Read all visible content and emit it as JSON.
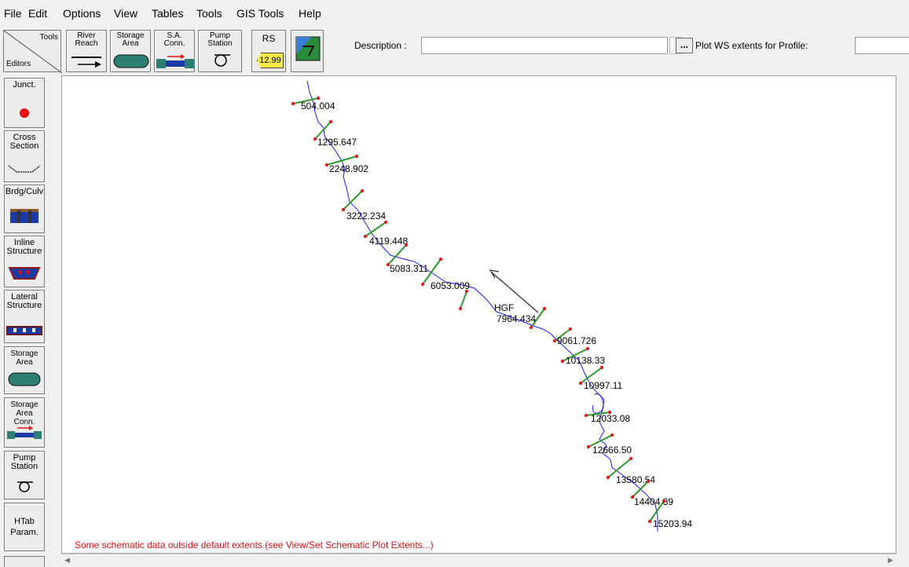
{
  "menu": [
    "File",
    "Edit",
    "Options",
    "View",
    "Tables",
    "Tools",
    "GIS Tools",
    "Help"
  ],
  "corner": {
    "tools": "Tools",
    "editors": "Editors"
  },
  "toolbar": {
    "river_reach": "River\nReach",
    "storage_area": "Storage\nArea",
    "sa_conn": "S.A.\nConn.",
    "pump_station": "Pump\nStation",
    "rs": "RS",
    "rs_value": "12.99",
    "description_label": "Description :",
    "description_value": "",
    "ellipsis": "...",
    "plot_ws_label": "Plot WS extents for Profile:"
  },
  "editors": [
    {
      "key": "junct",
      "label": "Junct."
    },
    {
      "key": "cross-section",
      "label": "Cross\nSection"
    },
    {
      "key": "bridge-culvert",
      "label": "Brdg/Culv"
    },
    {
      "key": "inline-structure",
      "label": "Inline\nStructure"
    },
    {
      "key": "lateral-structure",
      "label": "Lateral\nStructure"
    },
    {
      "key": "storage-area",
      "label": "Storage\nArea"
    },
    {
      "key": "storage-area-conn",
      "label": "Storage\nArea Conn."
    },
    {
      "key": "pump-station",
      "label": "Pump\nStation"
    },
    {
      "key": "htab-param",
      "label": "HTab\nParam."
    }
  ],
  "schematic": {
    "river_label": "HGF",
    "cross_sections": [
      "504.004",
      "1295.647",
      "2248.902",
      "3222.234",
      "4119.448",
      "5083.311",
      "6053.009",
      "7964.434",
      "9061.726",
      "10138.33",
      "10997.11",
      "12033.08",
      "12666.50",
      "13580.54",
      "14404.89",
      "15203.94"
    ],
    "warning": "Some schematic data outside default extents (see View/Set Schematic Plot Extents...)"
  },
  "colors": {
    "river": "#1a1aff",
    "xs_line": "#2e9b2e",
    "xs_end": "#e02020",
    "warning": "#e01010",
    "junction": "#e81010"
  }
}
